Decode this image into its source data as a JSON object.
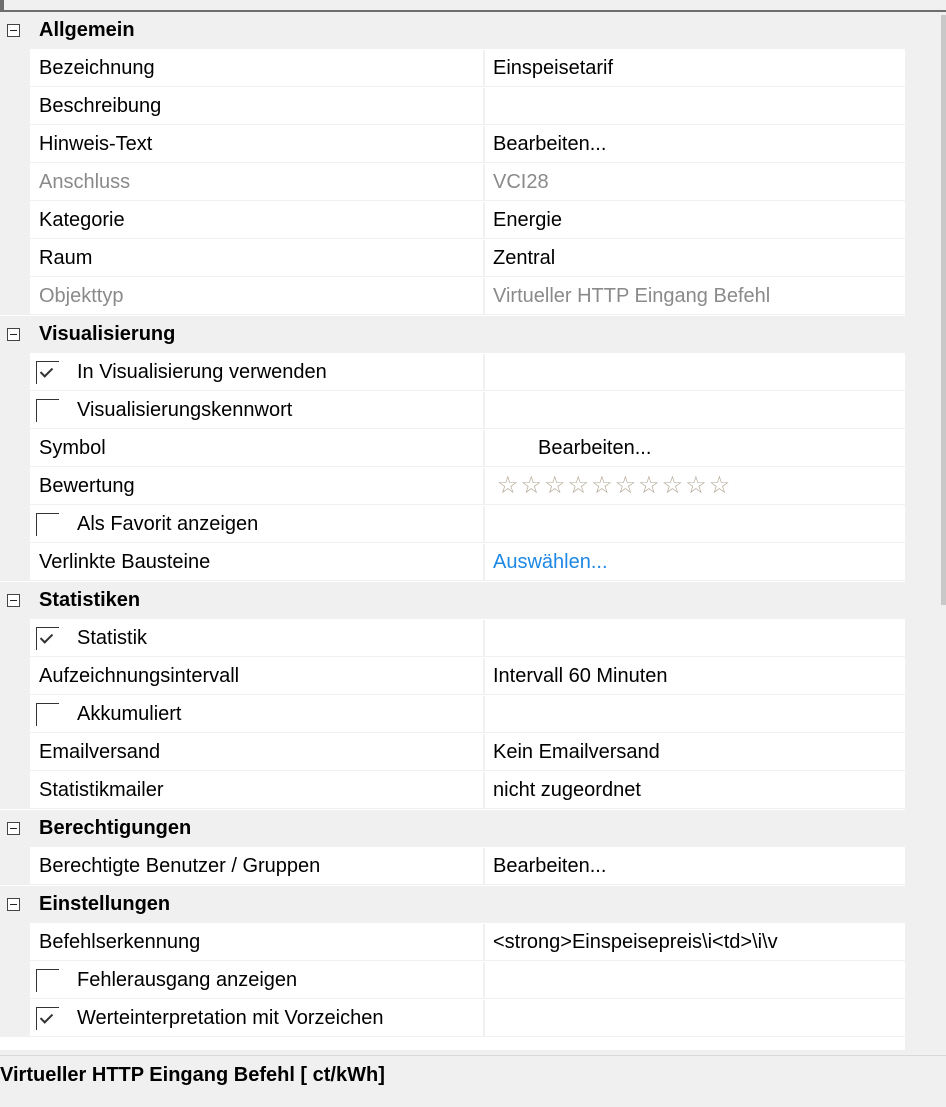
{
  "categories": [
    {
      "label": "Allgemein",
      "rows": [
        {
          "name": "Bezeichnung",
          "value": "Einspeisetarif"
        },
        {
          "name": "Beschreibung",
          "value": ""
        },
        {
          "name": "Hinweis-Text",
          "value": "Bearbeiten..."
        },
        {
          "name": "Anschluss",
          "value": "VCI28",
          "disabled": true
        },
        {
          "name": "Kategorie",
          "value": "Energie"
        },
        {
          "name": "Raum",
          "value": "Zentral"
        },
        {
          "name": "Objekttyp",
          "value": "Virtueller HTTP Eingang Befehl",
          "disabled": true
        }
      ]
    },
    {
      "label": "Visualisierung",
      "rows": [
        {
          "name": "In Visualisierung verwenden",
          "value": "",
          "checkbox": true,
          "checked": true
        },
        {
          "name": "Visualisierungskennwort",
          "value": "",
          "checkbox": true,
          "checked": false
        },
        {
          "name": "Symbol",
          "value": "Bearbeiten...",
          "indented_value": true
        },
        {
          "name": "Bewertung",
          "value": "",
          "rating": {
            "stars": 10,
            "filled": 0
          }
        },
        {
          "name": "Als Favorit anzeigen",
          "value": "",
          "checkbox": true,
          "checked": false
        },
        {
          "name": "Verlinkte Bausteine",
          "value": "Auswählen...",
          "link": true
        }
      ]
    },
    {
      "label": "Statistiken",
      "rows": [
        {
          "name": "Statistik",
          "value": "",
          "checkbox": true,
          "checked": true
        },
        {
          "name": "Aufzeichnungsintervall",
          "value": "Intervall 60 Minuten"
        },
        {
          "name": "Akkumuliert",
          "value": "",
          "checkbox": true,
          "checked": false
        },
        {
          "name": "Emailversand",
          "value": "Kein Emailversand"
        },
        {
          "name": "Statistikmailer",
          "value": "nicht zugeordnet"
        }
      ]
    },
    {
      "label": "Berechtigungen",
      "rows": [
        {
          "name": "Berechtigte Benutzer / Gruppen",
          "value": "Bearbeiten..."
        }
      ]
    },
    {
      "label": "Einstellungen",
      "rows": [
        {
          "name": "Befehlserkennung",
          "value": "<strong>Einspeisepreis\\i<td>\\i\\v"
        },
        {
          "name": "Fehlerausgang anzeigen",
          "value": "",
          "checkbox": true,
          "checked": false
        },
        {
          "name": "Werteinterpretation mit Vorzeichen",
          "value": "",
          "checkbox": true,
          "checked": true
        }
      ]
    }
  ],
  "description": "Virtueller HTTP Eingang Befehl [ ct/kWh]",
  "colors": {
    "link": "#1e88e5",
    "disabled_text": "#8a8a8a",
    "star": "#b5a898"
  }
}
